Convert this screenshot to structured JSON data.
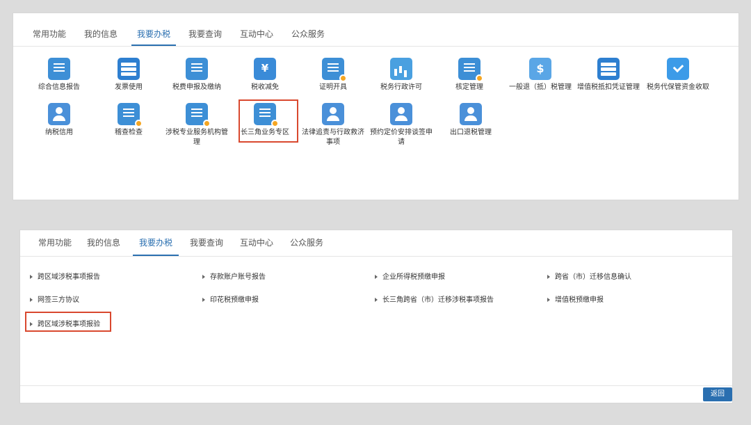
{
  "panel1": {
    "tabs": [
      "常用功能",
      "我的信息",
      "我要办税",
      "我要查询",
      "互动中心",
      "公众服务"
    ],
    "active_tab": "我要办税",
    "items": [
      {
        "label": "综合信息报告",
        "icon": "info-report-icon"
      },
      {
        "label": "发票使用",
        "icon": "invoice-icon"
      },
      {
        "label": "税费申报及缴纳",
        "icon": "tax-declare-icon"
      },
      {
        "label": "税收减免",
        "icon": "tax-relief-icon"
      },
      {
        "label": "证明开具",
        "icon": "certificate-icon"
      },
      {
        "label": "税务行政许可",
        "icon": "license-chart-icon"
      },
      {
        "label": "核定管理",
        "icon": "verification-icon"
      },
      {
        "label": "一般退（抵）税管理",
        "icon": "refund-icon"
      },
      {
        "label": "增值税抵扣凭证管理",
        "icon": "vat-voucher-icon"
      },
      {
        "label": "税务代保管资金收取",
        "icon": "custody-fund-icon"
      },
      {
        "label": "纳税信用",
        "icon": "credit-icon"
      },
      {
        "label": "稽查检查",
        "icon": "inspection-icon"
      },
      {
        "label": "涉税专业服务机构管理",
        "icon": "agency-icon"
      },
      {
        "label": "长三角业务专区",
        "icon": "yangtze-delta-icon"
      },
      {
        "label": "法律追责与行政救济事项",
        "icon": "legal-icon"
      },
      {
        "label": "预约定价安排谈签申请",
        "icon": "pricing-icon"
      },
      {
        "label": "出口退税管理",
        "icon": "export-refund-icon"
      }
    ]
  },
  "panel2": {
    "tabs": [
      "常用功能",
      "我的信息",
      "我要办税",
      "我要查询",
      "互动中心",
      "公众服务"
    ],
    "active_tab": "我要办税",
    "items": [
      "跨区域涉税事项报告",
      "存款账户账号报告",
      "企业所得税预缴申报",
      "跨省（市）迁移信息确认",
      "网签三方协议",
      "印花税预缴申报",
      "长三角跨省（市）迁移涉税事项报告",
      "增值税预缴申报",
      "跨区域涉税事项报验"
    ],
    "back_label": "返回"
  },
  "colors": {
    "accent": "#2a6fb0",
    "highlight": "#d9482e"
  }
}
